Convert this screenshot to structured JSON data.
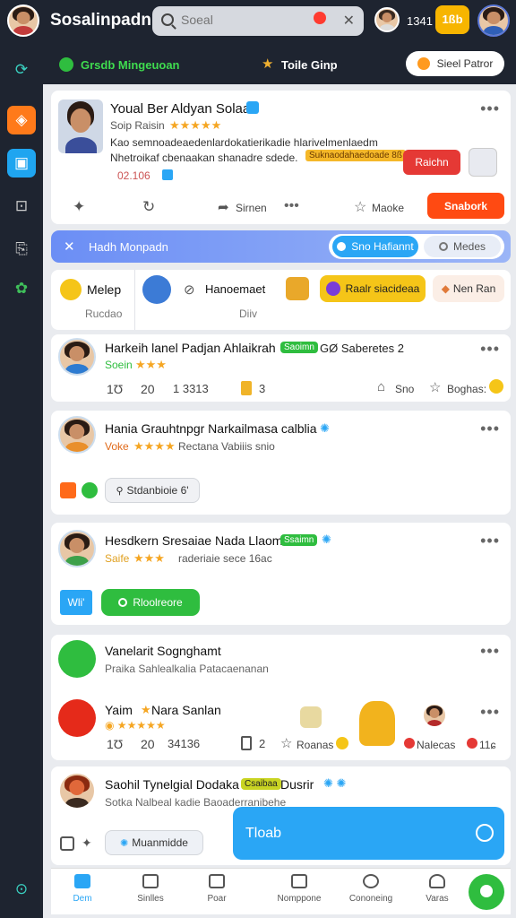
{
  "header": {
    "app_title": "Sosalinpadn",
    "search_placeholder": "Soeal",
    "count": "1341",
    "gift_label": "1ßb"
  },
  "subbar": {
    "left_chip": "Grsdb Mingeuoan",
    "center_chip": "Toile Ginp",
    "right_button": "Sieel Patror"
  },
  "post1": {
    "name": "Youal Ber Aldyan Solaai",
    "sub": "Soip Raisin",
    "line1": "Kao semnoadeaedenlardokatierikadie hlarivelmenlaedm",
    "line2": "Nhetroikaf cbenaakan shanadre sdede.",
    "tag": "Suknaodahaedoade 8ß",
    "time": "02.106",
    "action_btn": "Raichn",
    "footer_share": "Sirnen",
    "footer_more": "Maoke",
    "cta": "Snabork"
  },
  "filter_bar": {
    "label": "Hadh Monpadn",
    "chip1": "Sno Hafiannt",
    "chip2": "Medes"
  },
  "stories": {
    "s1_title": "Melep",
    "s1_sub": "Rucdao",
    "s2_label": "Hanoemaet",
    "s2_sub": "Diiv",
    "s3_label": "Raalr siacideaa",
    "s4_label": "Nen Ran"
  },
  "post2": {
    "name": "Harkeih lanel Padjan Ahlaikrah",
    "badge": "Saoimn",
    "extra": "GØ Saberetes 2",
    "sub": "Soein",
    "stat1": "1Ʊ",
    "stat2": "20",
    "stat3": "1 3313",
    "stat4": "3",
    "action1": "Sno",
    "action2": "Boghas:"
  },
  "post3": {
    "name": "Hania Grauhtnpgr Narkailmasa calblia",
    "sub": "Voke",
    "sub2": "Rectana Vabiiis snio",
    "chip": "Stdanbioie 6'"
  },
  "post4": {
    "name": "Hesdkern Sresaiae Nada Llaom",
    "badge": "Ssaimn",
    "sub": "Saife",
    "sub2": "raderiaie sece 16ac",
    "tag": "Wli'",
    "green_btn": "Rloolreore"
  },
  "post5": {
    "name": "Vanelarit Sognghamt",
    "sub": "Praika Sahlealkalia Patacaenanan",
    "name2": "Yaim",
    "name2b": "Nara Sanlan",
    "stat1": "1Ʊ",
    "stat2": "20",
    "stat3": "34136",
    "stat4": "2",
    "action1": "Roanas",
    "action2": "Nalecas",
    "action3": "11ɕ"
  },
  "post6": {
    "name": "Saohil Tynelgial Dodaka",
    "badge": "Csaibaa",
    "name_tail": "Dusrir",
    "sub": "Sotka Nalbeal kadie Baoaderranibehe",
    "chip": "Muanmidde"
  },
  "floating_button": "Tloab",
  "bottom_nav": [
    "Dem",
    "Sinlles",
    "Poar",
    "Nomppone",
    "Cononeing",
    "Varas"
  ],
  "colors": {
    "accent_green": "#2fbd3f",
    "accent_orange": "#ff5a1f",
    "accent_blue": "#2aa6f5"
  }
}
